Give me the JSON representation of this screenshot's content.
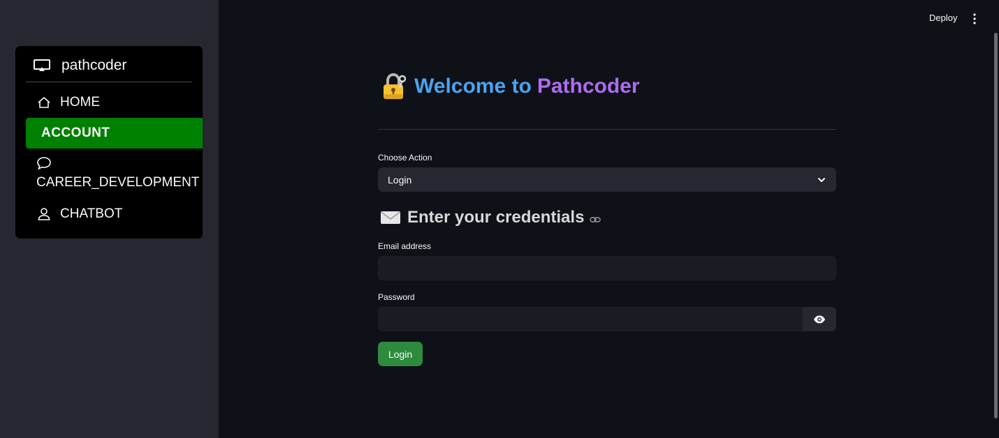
{
  "sidebar": {
    "brand": "pathcoder",
    "brand_icon": "monitor-icon",
    "items": [
      {
        "label": "HOME",
        "icon": "home-icon",
        "active": false
      },
      {
        "label": "ACCOUNT",
        "active": true
      },
      {
        "label": "CAREER_DEVELOPMENT",
        "icon": "chat-bubble-icon",
        "active": false
      },
      {
        "label": "CHATBOT",
        "icon": "user-icon",
        "active": false
      }
    ],
    "active_color": "#008000"
  },
  "topbar": {
    "deploy_label": "Deploy",
    "menu_icon": "vertical-dots-icon"
  },
  "main": {
    "title_icon": "lock-with-key-emoji",
    "title_prefix": "Welcome to",
    "title_brand": "Pathcoder",
    "title_color": "#4aa3f0",
    "brand_color": "#b06bf0",
    "choose_action_label": "Choose Action",
    "choose_action_value": "Login",
    "credentials_icon": "envelope-emoji",
    "credentials_heading": "Enter your credentials",
    "email_label": "Email address",
    "email_value": "",
    "password_label": "Password",
    "password_value": "",
    "login_button": "Login",
    "login_button_color": "#2e8b3e"
  }
}
